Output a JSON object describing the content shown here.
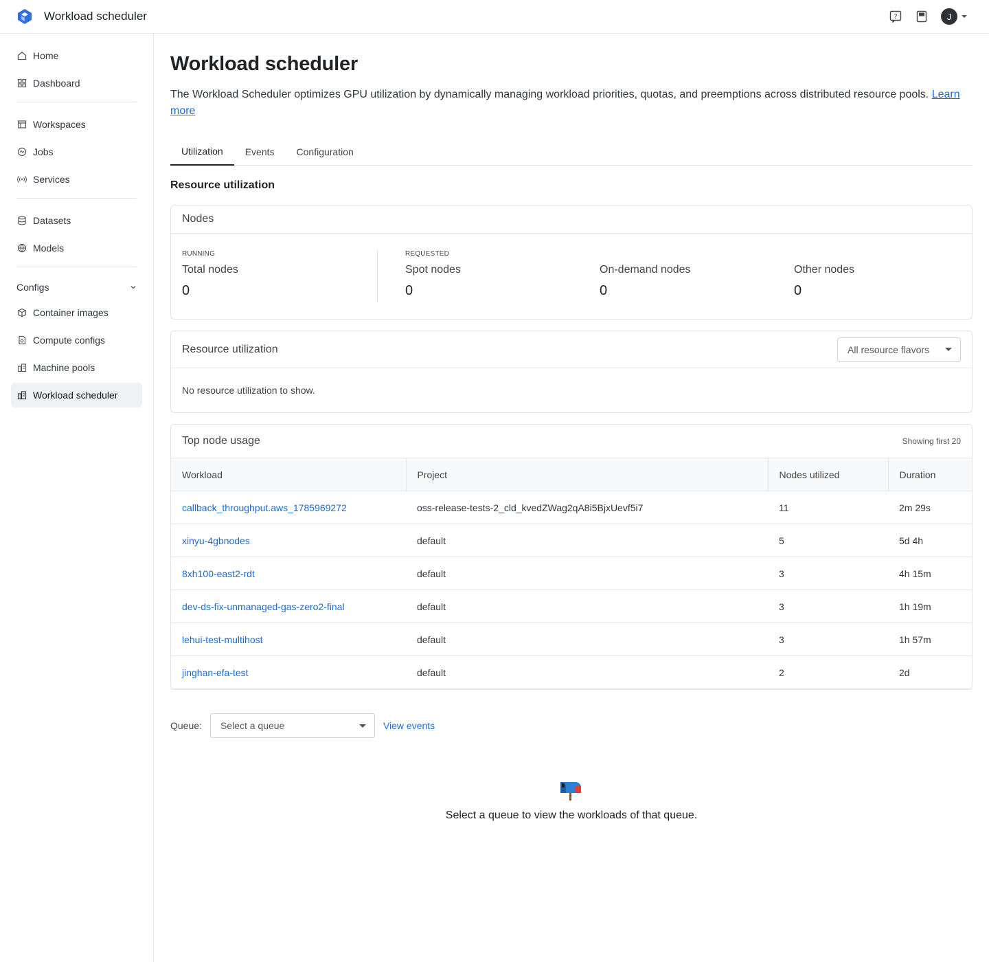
{
  "app": {
    "title": "Workload scheduler",
    "user_initial": "J"
  },
  "icons": {
    "logo": "logo-icon",
    "help": "help-icon",
    "docs": "book-icon",
    "user": "avatar"
  },
  "sidebar": {
    "items": [
      {
        "label": "Home",
        "icon": "home-icon"
      },
      {
        "label": "Dashboard",
        "icon": "dashboard-icon"
      },
      {
        "label": "Workspaces",
        "icon": "workspace-icon"
      },
      {
        "label": "Jobs",
        "icon": "jobs-icon"
      },
      {
        "label": "Services",
        "icon": "services-icon"
      },
      {
        "label": "Datasets",
        "icon": "dataset-icon"
      },
      {
        "label": "Models",
        "icon": "models-icon"
      }
    ],
    "group": {
      "label": "Configs"
    },
    "config_items": [
      {
        "label": "Container images",
        "icon": "container-icon"
      },
      {
        "label": "Compute configs",
        "icon": "compute-icon"
      },
      {
        "label": "Machine pools",
        "icon": "machine-pool-icon"
      },
      {
        "label": "Workload scheduler",
        "icon": "scheduler-icon",
        "active": true
      }
    ]
  },
  "main": {
    "title": "Workload scheduler",
    "description": "The Workload Scheduler optimizes GPU utilization by dynamically managing workload priorities, quotas, and preemptions across distributed resource pools.",
    "learn_more": "Learn more",
    "tabs": [
      "Utilization",
      "Events",
      "Configuration"
    ],
    "section_title": "Resource utilization",
    "nodes": {
      "title": "Nodes",
      "running_label": "RUNNING",
      "requested_label": "REQUESTED",
      "total_label": "Total nodes",
      "total_value": "0",
      "spot_label": "Spot nodes",
      "spot_value": "0",
      "ondemand_label": "On-demand nodes",
      "ondemand_value": "0",
      "other_label": "Other nodes",
      "other_value": "0"
    },
    "resource": {
      "title": "Resource utilization",
      "flavor_select": "All resource flavors",
      "empty": "No resource utilization to show."
    },
    "top_nodes": {
      "title": "Top node usage",
      "showing": "Showing first 20",
      "columns": [
        "Workload",
        "Project",
        "Nodes utilized",
        "Duration"
      ],
      "rows": [
        {
          "workload": "callback_throughput.aws_1785969272",
          "project": "oss-release-tests-2_cld_kvedZWag2qA8i5BjxUevf5i7",
          "nodes": "11",
          "duration": "2m 29s"
        },
        {
          "workload": "xinyu-4gbnodes",
          "project": "default",
          "nodes": "5",
          "duration": "5d 4h"
        },
        {
          "workload": "8xh100-east2-rdt",
          "project": "default",
          "nodes": "3",
          "duration": "4h 15m"
        },
        {
          "workload": "dev-ds-fix-unmanaged-gas-zero2-final",
          "project": "default",
          "nodes": "3",
          "duration": "1h 19m"
        },
        {
          "workload": "lehui-test-multihost",
          "project": "default",
          "nodes": "3",
          "duration": "1h 57m"
        },
        {
          "workload": "jinghan-efa-test",
          "project": "default",
          "nodes": "2",
          "duration": "2d"
        }
      ]
    },
    "queue": {
      "label": "Queue:",
      "placeholder": "Select a queue",
      "view_events": "View events",
      "empty_message": "Select a queue to view the workloads of that queue."
    }
  },
  "colors": {
    "link": "#1a6bd6",
    "accent": "#1a6bd6",
    "logo": "#2f6fe0"
  }
}
